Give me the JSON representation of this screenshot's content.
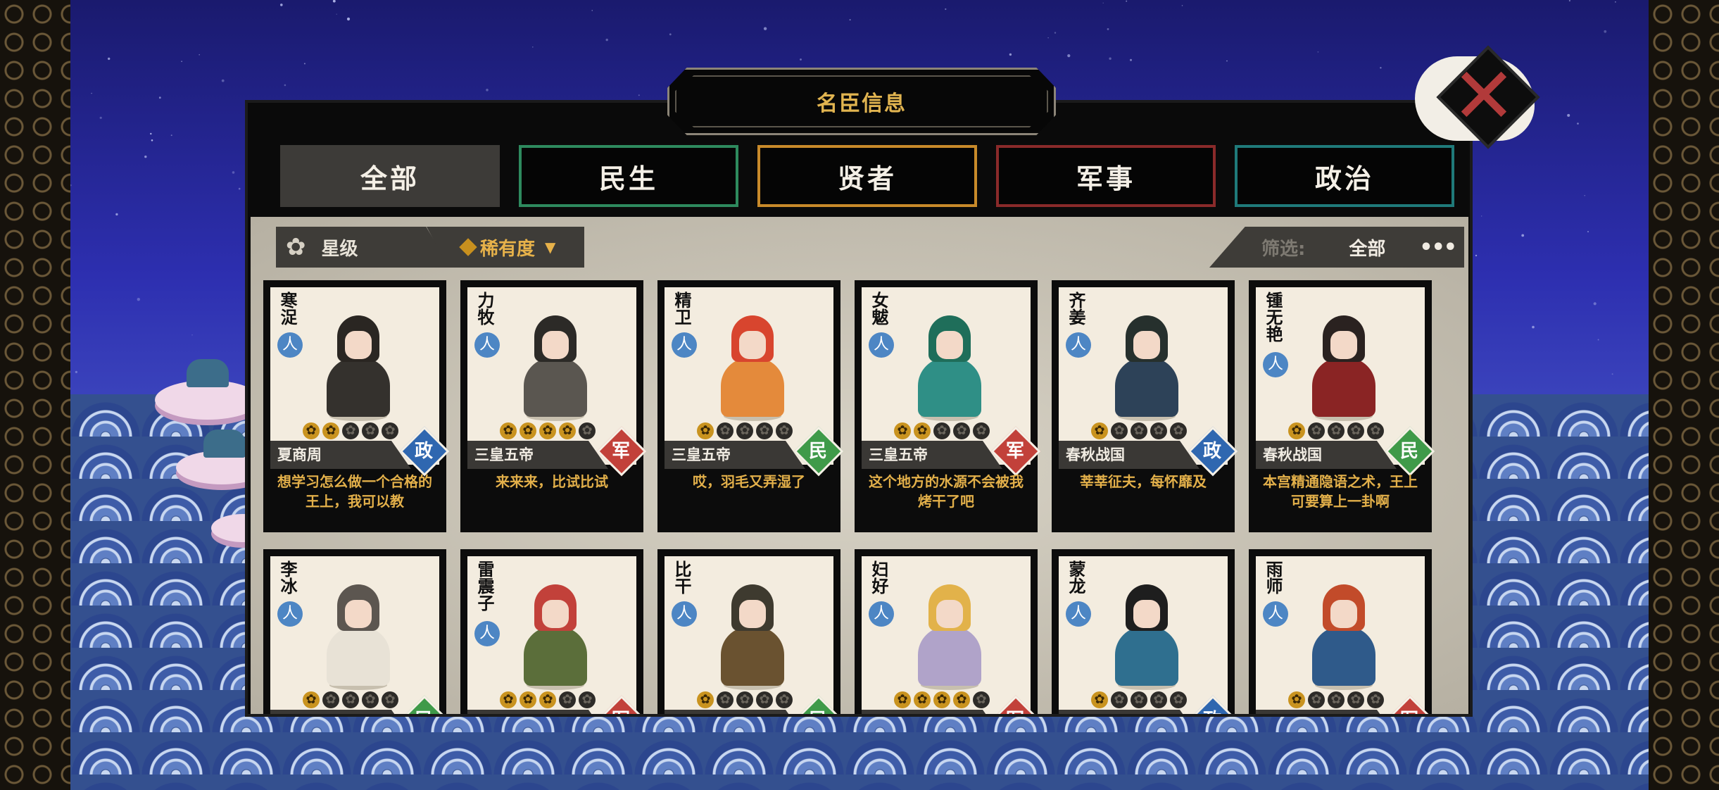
{
  "title": "名臣信息",
  "close_icon": "close-x-icon",
  "tabs": [
    {
      "label": "全部",
      "active": true,
      "border": "#3d3b38"
    },
    {
      "label": "民生",
      "active": false,
      "border": "#2e8a5e"
    },
    {
      "label": "贤者",
      "active": false,
      "border": "#c88a2a"
    },
    {
      "label": "军事",
      "active": false,
      "border": "#8a2a2a"
    },
    {
      "label": "政治",
      "active": false,
      "border": "#1f7a7a"
    }
  ],
  "filters": {
    "star_label": "星级",
    "rarity_label": "稀有度",
    "screen_label": "筛选:",
    "screen_value": "全部",
    "more": "•••"
  },
  "type_colors": {
    "政": "#2f67b0",
    "军": "#c2413a",
    "民": "#3f9a49"
  },
  "cards": [
    {
      "name": "寒浞",
      "stars": 2,
      "era": "夏商周",
      "type": "政",
      "quote": "想学习怎么做一个合格的王上，我可以教",
      "hair": "#2a2622",
      "robe": "#34312d"
    },
    {
      "name": "力牧",
      "stars": 4,
      "era": "三皇五帝",
      "type": "军",
      "quote": "来来来，比试比试",
      "hair": "#2c2a27",
      "robe": "#5a5650"
    },
    {
      "name": "精卫",
      "stars": 1,
      "era": "三皇五帝",
      "type": "民",
      "quote": "哎，羽毛又弄湿了",
      "hair": "#d8452e",
      "robe": "#e48a3b"
    },
    {
      "name": "女魃",
      "stars": 2,
      "era": "三皇五帝",
      "type": "军",
      "quote": "这个地方的水源不会被我烤干了吧",
      "hair": "#1f6e5a",
      "robe": "#2f8f86"
    },
    {
      "name": "齐姜",
      "stars": 1,
      "era": "春秋战国",
      "type": "政",
      "quote": "莘莘征夫，每怀靡及",
      "hair": "#26302d",
      "robe": "#2d4258"
    },
    {
      "name": "锺无艳",
      "stars": 1,
      "era": "春秋战国",
      "type": "民",
      "quote": "本宫精通隐语之术，王上可要算上一卦啊",
      "hair": "#2a2220",
      "robe": "#8a2424"
    },
    {
      "name": "李冰",
      "stars": 1,
      "era": "",
      "type": "民",
      "quote": "",
      "hair": "#5c5650",
      "robe": "#e8e2d6"
    },
    {
      "name": "雷震子",
      "stars": 3,
      "era": "",
      "type": "军",
      "quote": "",
      "hair": "#c2413a",
      "robe": "#5b6e3a"
    },
    {
      "name": "比干",
      "stars": 1,
      "era": "",
      "type": "民",
      "quote": "",
      "hair": "#3e3a2f",
      "robe": "#6a5230"
    },
    {
      "name": "妇好",
      "stars": 4,
      "era": "",
      "type": "军",
      "quote": "",
      "hair": "#e2b24a",
      "robe": "#b0a3c9"
    },
    {
      "name": "蒙龙",
      "stars": 1,
      "era": "",
      "type": "政",
      "quote": "",
      "hair": "#1e1e1e",
      "robe": "#2f6f8f"
    },
    {
      "name": "雨师",
      "stars": 1,
      "era": "",
      "type": "军",
      "quote": "",
      "hair": "#c24b2a",
      "robe": "#2f5a8a"
    }
  ]
}
